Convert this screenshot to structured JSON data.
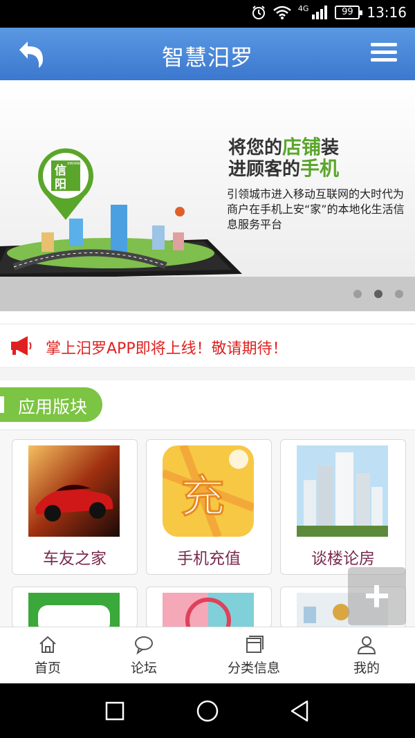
{
  "status_bar": {
    "network": "4G",
    "battery": "99",
    "time": "13:16",
    "icons": [
      "alarm-icon",
      "wifi-icon",
      "signal-icon",
      "battery-icon"
    ]
  },
  "header": {
    "title": "智慧汨罗",
    "back_icon": "back-arrow-icon",
    "menu_icon": "menu-icon"
  },
  "banner": {
    "logo_text_1": "信",
    "logo_text_2": "阳",
    "logo_text_3": "XINYANG",
    "headline_part1": "将您的",
    "headline_accent1": "店铺",
    "headline_part2": "装",
    "headline_part3": "进顾客的",
    "headline_accent2": "手机",
    "subtext": "引领城市进入移动互联网的大时代为商户在手机上安“家”的本地化生活信息服务平台",
    "active_slide": 2,
    "slide_count": 3
  },
  "notice": {
    "icon": "megaphone-icon",
    "text": "掌上汨罗APP即将上线！敬请期待！"
  },
  "section": {
    "title": "应用版块"
  },
  "apps": [
    {
      "label": "车友之家",
      "icon": "car-thumbnail"
    },
    {
      "label": "手机充值",
      "icon": "recharge-thumbnail"
    },
    {
      "label": "谈楼论房",
      "icon": "buildings-thumbnail"
    },
    {
      "label": "",
      "icon": "convenience-thumbnail"
    },
    {
      "label": "",
      "icon": "pink-thumbnail"
    },
    {
      "label": "",
      "icon": "room-thumbnail"
    }
  ],
  "fab": {
    "icon": "plus-icon"
  },
  "bottom_nav": [
    {
      "label": "首页",
      "icon": "home-icon"
    },
    {
      "label": "论坛",
      "icon": "chat-bubble-icon"
    },
    {
      "label": "分类信息",
      "icon": "category-icon"
    },
    {
      "label": "我的",
      "icon": "user-icon"
    }
  ],
  "colors": {
    "header": "#4a88d8",
    "accent_green": "#7cc443",
    "notice_red": "#e02020",
    "app_label": "#7a2a4e"
  }
}
